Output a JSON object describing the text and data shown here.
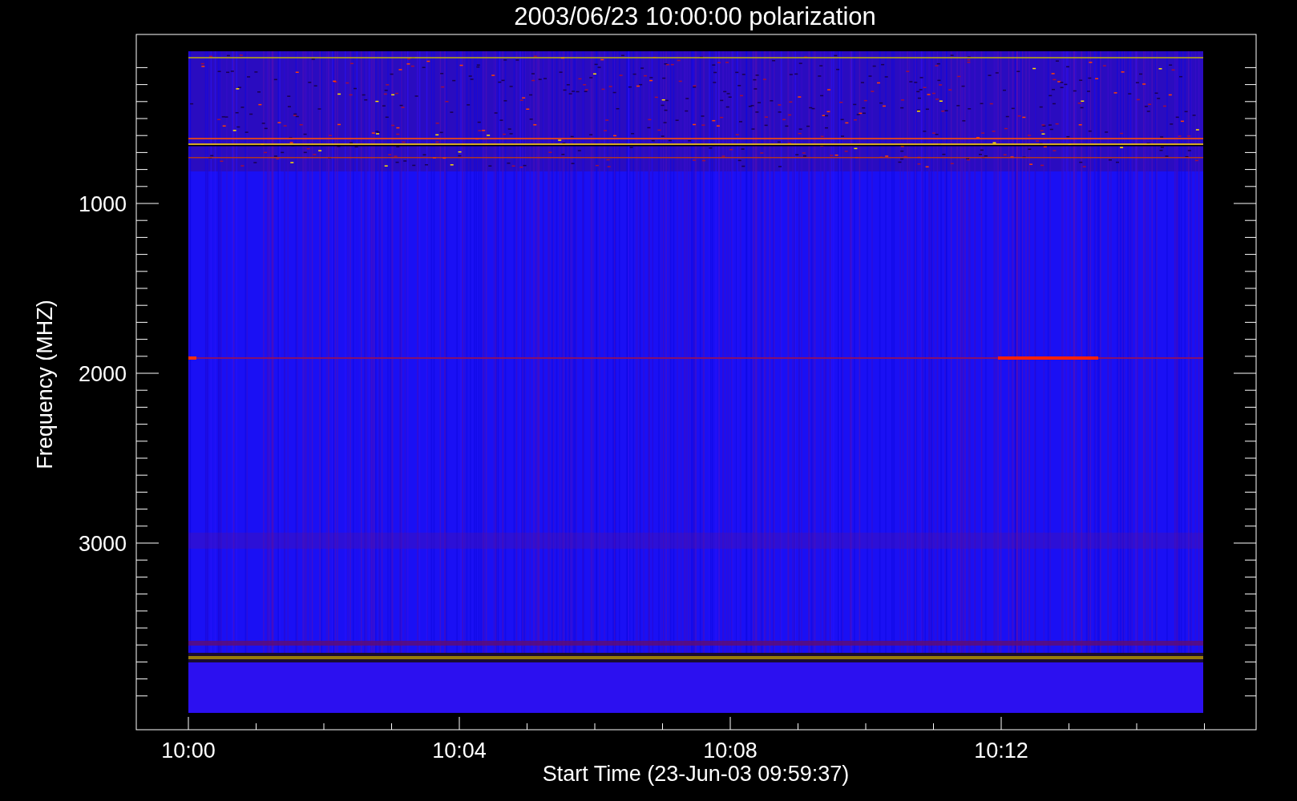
{
  "title": "2003/06/23 10:00:00 polarization",
  "y_axis": {
    "label": "Frequency (MHZ)",
    "ticks": [
      "1000",
      "2000",
      "3000"
    ]
  },
  "x_axis": {
    "label": "Start Time (23-Jun-03 09:59:37)",
    "ticks": [
      "10:00",
      "10:04",
      "10:08",
      "10:12"
    ]
  }
}
